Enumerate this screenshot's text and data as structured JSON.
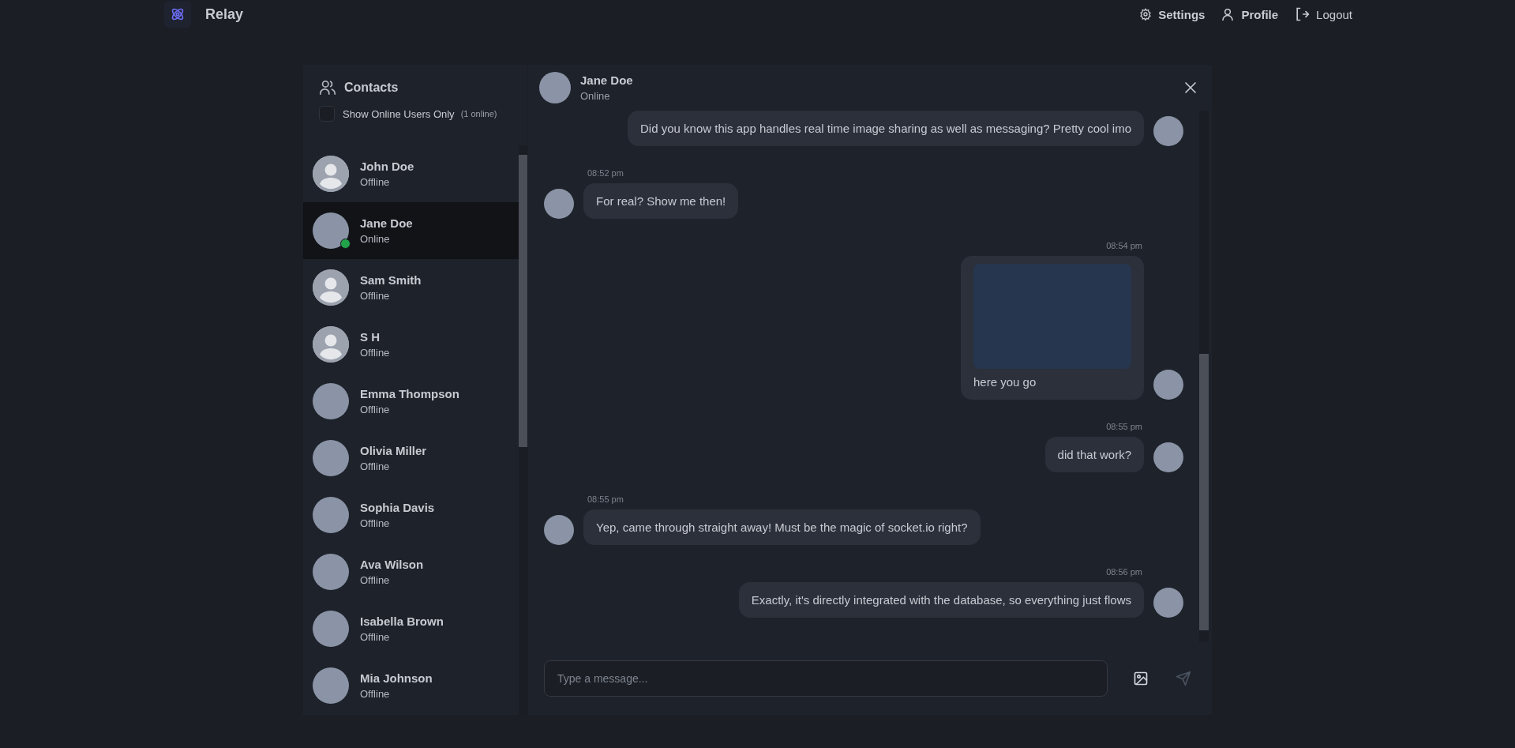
{
  "app": {
    "name": "Relay"
  },
  "nav": [
    {
      "kind": "settings",
      "label": "Settings"
    },
    {
      "kind": "profile",
      "label": "Profile"
    },
    {
      "kind": "logout",
      "label": "Logout"
    }
  ],
  "sidebar": {
    "title": "Contacts",
    "filter": {
      "label": "Show Online Users Only",
      "checked": false,
      "count": "(1 online)"
    },
    "contacts": [
      {
        "name": "John Doe",
        "status": "Offline",
        "online": false,
        "selected": false,
        "kind": "default"
      },
      {
        "name": "Jane Doe",
        "status": "Online",
        "online": true,
        "selected": true,
        "kind": "photo"
      },
      {
        "name": "Sam Smith",
        "status": "Offline",
        "online": false,
        "selected": false,
        "kind": "default"
      },
      {
        "name": "S H",
        "status": "Offline",
        "online": false,
        "selected": false,
        "kind": "default"
      },
      {
        "name": "Emma Thompson",
        "status": "Offline",
        "online": false,
        "selected": false,
        "kind": "photo"
      },
      {
        "name": "Olivia Miller",
        "status": "Offline",
        "online": false,
        "selected": false,
        "kind": "photo"
      },
      {
        "name": "Sophia Davis",
        "status": "Offline",
        "online": false,
        "selected": false,
        "kind": "photo"
      },
      {
        "name": "Ava Wilson",
        "status": "Offline",
        "online": false,
        "selected": false,
        "kind": "photo"
      },
      {
        "name": "Isabella Brown",
        "status": "Offline",
        "online": false,
        "selected": false,
        "kind": "photo"
      },
      {
        "name": "Mia Johnson",
        "status": "Offline",
        "online": false,
        "selected": false,
        "kind": "photo"
      }
    ]
  },
  "chat": {
    "name": "Jane Doe",
    "status": "Online",
    "messages": [
      {
        "kind": "sent",
        "text": "Did you know this app handles real time image sharing as well as messaging? Pretty cool imo"
      },
      {
        "kind": "received",
        "time": "08:52 pm",
        "text": "For real? Show me then!"
      },
      {
        "kind": "sent",
        "time": "08:54 pm",
        "image": true,
        "text": "here you go"
      },
      {
        "kind": "sent",
        "time": "08:55 pm",
        "text": "did that work?"
      },
      {
        "kind": "received",
        "time": "08:55 pm",
        "text": "Yep, came through straight away! Must be the magic of socket.io right?"
      },
      {
        "kind": "sent",
        "time": "08:56 pm",
        "text": "Exactly, it's directly integrated with the database, so everything just flows"
      }
    ],
    "input": {
      "placeholder": "Type a message..."
    }
  }
}
